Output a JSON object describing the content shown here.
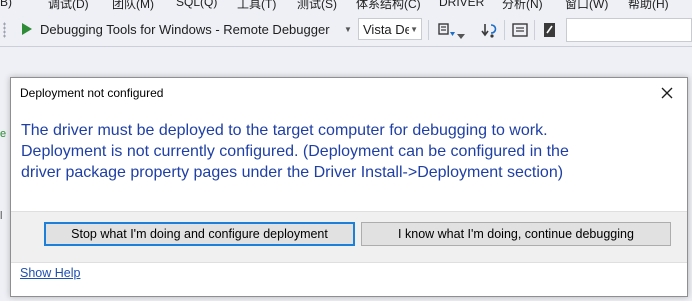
{
  "menubar": {
    "items": [
      "E(B)",
      "调试(D)",
      "团队(M)",
      "SQL(Q)",
      "工具(T)",
      "测试(S)",
      "体系结构(C)",
      "DRIVER",
      "分析(N)",
      "窗口(W)",
      "帮助(H)"
    ]
  },
  "toolbar": {
    "run_label": "Debugging Tools for Windows - Remote Debugger",
    "target_value": "Vista De",
    "icons": [
      "play-icon",
      "deploy-icon",
      "step-into-icon",
      "breakpoints-icon",
      "memory-icon"
    ]
  },
  "dialog": {
    "title": "Deployment not configured",
    "message_lines": [
      "The driver must be deployed to the target computer for debugging to work.",
      "Deployment is not currently configured.  (Deployment can be configured in the",
      "driver package property pages under the Driver Install->Deployment section)"
    ],
    "primary_button": "Stop what I'm doing and configure deployment",
    "secondary_button": "I know what I'm doing, continue debugging",
    "help_link": "Show Help"
  },
  "colors": {
    "message_text": "#1f3fa5",
    "primary_button_border": "#1e7fd8",
    "link": "#1f4fb0",
    "ide_background": "#eef0f5"
  }
}
